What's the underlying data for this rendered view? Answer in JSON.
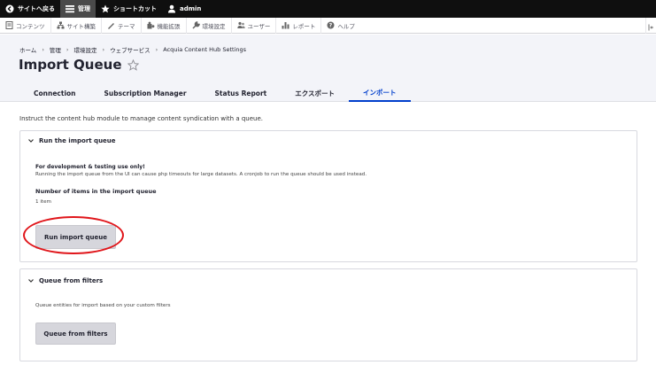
{
  "toolbar": {
    "back_site": "サイトへ戻る",
    "manage": "管理",
    "shortcuts": "ショートカット",
    "user": "admin"
  },
  "admin_menu": {
    "items": [
      {
        "label": "コンテンツ",
        "icon": "content-icon"
      },
      {
        "label": "サイト構築",
        "icon": "structure-icon"
      },
      {
        "label": "テーマ",
        "icon": "appearance-icon"
      },
      {
        "label": "機能拡張",
        "icon": "extend-icon"
      },
      {
        "label": "環境設定",
        "icon": "config-icon"
      },
      {
        "label": "ユーザー",
        "icon": "people-icon"
      },
      {
        "label": "レポート",
        "icon": "reports-icon"
      },
      {
        "label": "ヘルプ",
        "icon": "help-icon"
      }
    ]
  },
  "breadcrumb": {
    "items": [
      "ホーム",
      "管理",
      "環境設定",
      "ウェブサービス",
      "Acquia Content Hub Settings"
    ],
    "separator": "›"
  },
  "page": {
    "title": "Import Queue",
    "intro": "Instruct the content hub module to manage content syndication with a queue."
  },
  "tabs": [
    {
      "label": "Connection",
      "active": false
    },
    {
      "label": "Subscription Manager",
      "active": false
    },
    {
      "label": "Status Report",
      "active": false
    },
    {
      "label": "エクスポート",
      "active": false
    },
    {
      "label": "インポート",
      "active": true
    }
  ],
  "import_panel": {
    "title": "Run the import queue",
    "dev_title": "For development & testing use only!",
    "dev_text": "Running the import queue from the UI can cause php timeouts for large datasets. A cronjob to run the queue should be used instead.",
    "count_label": "Number of items in the import queue",
    "count_value": "1 item",
    "button": "Run import queue"
  },
  "filters_panel": {
    "title": "Queue from filters",
    "text": "Queue entities for import based on your custom filters",
    "button": "Queue from filters"
  },
  "colors": {
    "toolbar_bg": "#0f0f0f",
    "active_tab": "#003ecc",
    "highlight": "#e0161b"
  }
}
